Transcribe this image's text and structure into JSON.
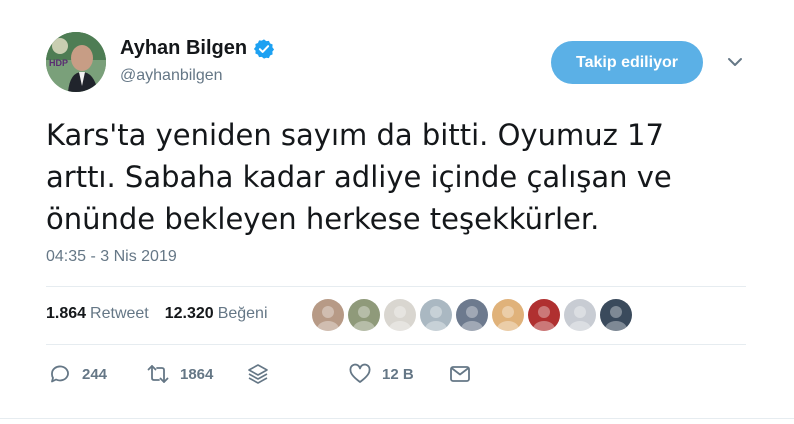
{
  "author": {
    "display_name": "Ayhan Bilgen",
    "handle": "@ayhanbilgen",
    "verified": true,
    "avatar_badge": "HDP"
  },
  "follow_button": {
    "label": "Takip ediliyor"
  },
  "tweet": {
    "text": "Kars'ta yeniden sayım da bitti. Oyumuz 17\narttı. Sabaha kadar adliye içinde çalışan  ve\nönünde bekleyen herkese teşekkürler.",
    "timestamp": "04:35 - 3 Nis 2019"
  },
  "stats": {
    "retweets_count": "1.864",
    "retweets_label": "Retweet",
    "likes_count": "12.320",
    "likes_label": "Beğeni"
  },
  "likers": [
    {
      "name": "liker-1",
      "color": "#b79a86"
    },
    {
      "name": "liker-2",
      "color": "#8f9a7a"
    },
    {
      "name": "liker-3",
      "color": "#d9d6d0"
    },
    {
      "name": "liker-4",
      "color": "#aab8c2"
    },
    {
      "name": "liker-5",
      "color": "#6d7a8e"
    },
    {
      "name": "liker-6",
      "color": "#e0b27a"
    },
    {
      "name": "liker-7",
      "color": "#b03030"
    },
    {
      "name": "liker-8",
      "color": "#c8ccd3"
    },
    {
      "name": "liker-9",
      "color": "#3a4a5c"
    }
  ],
  "actions": {
    "reply_count": "244",
    "retweet_count": "1864",
    "like_count": "12 B"
  },
  "colors": {
    "brand_blue": "#1da1f2",
    "follow_button_bg": "#5bb0e6",
    "secondary_text": "#657786"
  }
}
